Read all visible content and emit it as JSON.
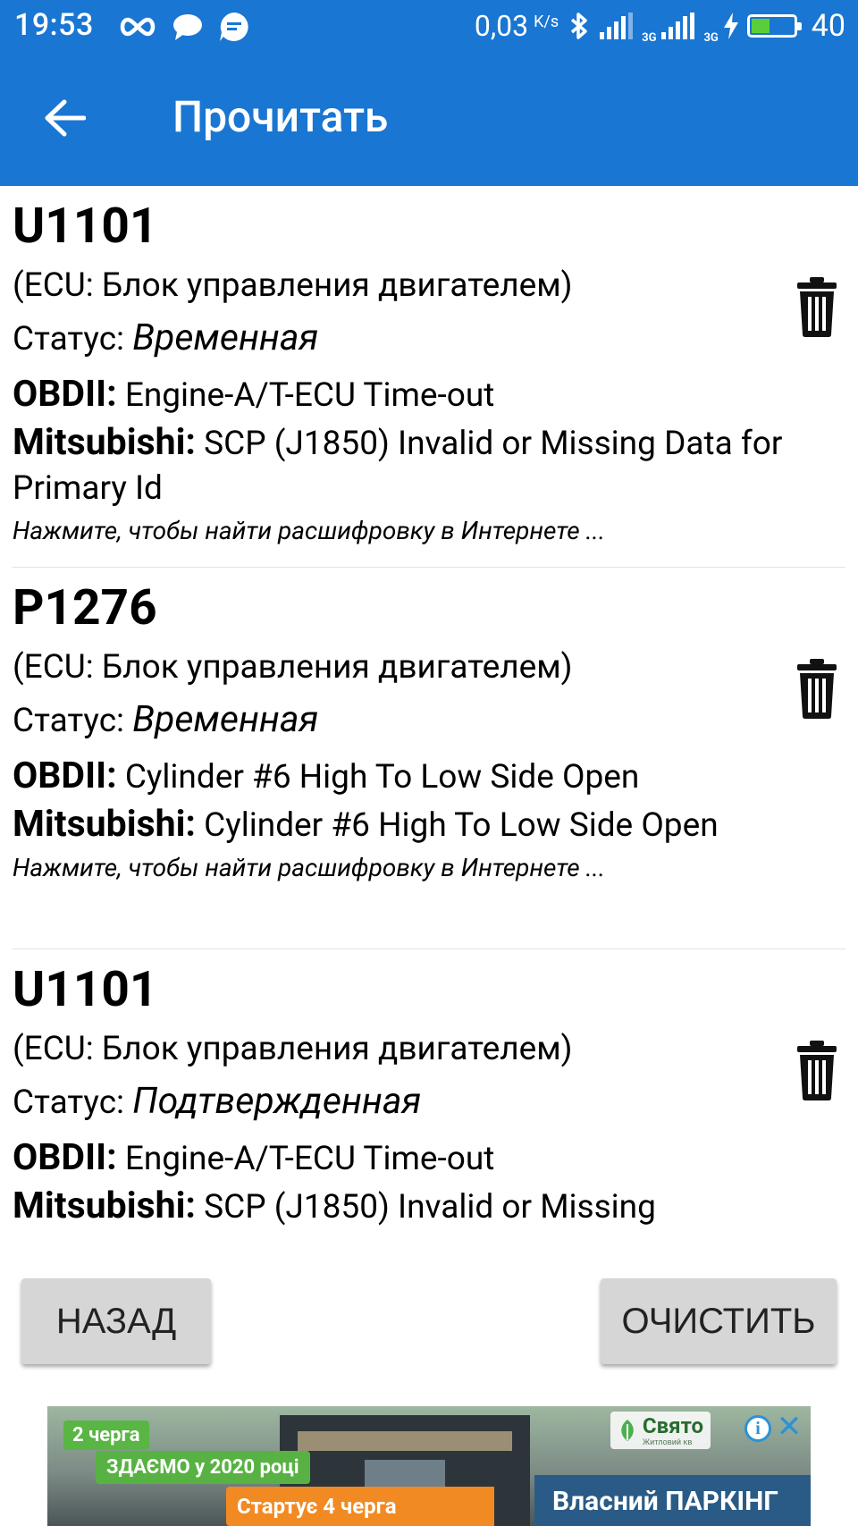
{
  "status_bar": {
    "time": "19:53",
    "net_speed": "0,03",
    "net_speed_unit": "K/s",
    "net_type_1": "3G",
    "net_type_2": "3G",
    "battery_level": "40"
  },
  "toolbar": {
    "title": "Прочитать"
  },
  "labels": {
    "status": "Статус: ",
    "obdii": "OBDII:",
    "mitsubishi": "Mitsubishi:"
  },
  "codes": [
    {
      "code": "U1101",
      "ecu": "(ECU: Блок управления двигателем)",
      "status": "Временная",
      "obdii": "Engine-A/T-ECU Time-out",
      "mitsubishi": "SCP (J1850) Invalid or Missing Data for Primary Id",
      "hint": "Нажмите, чтобы найти расшифровку в Интернете ..."
    },
    {
      "code": "P1276",
      "ecu": "(ECU: Блок управления двигателем)",
      "status": "Временная",
      "obdii": "Cylinder #6 High To Low Side Open",
      "mitsubishi": "Cylinder #6 High To Low Side Open",
      "hint": "Нажмите, чтобы найти расшифровку в Интернете ..."
    },
    {
      "code": "U1101",
      "ecu": "(ECU: Блок управления двигателем)",
      "status": "Подтвержденная",
      "obdii": "Engine-A/T-ECU Time-out",
      "mitsubishi": "SCP (J1850) Invalid or Missing",
      "hint": ""
    }
  ],
  "buttons": {
    "back": "НАЗАД",
    "clear": "ОЧИСТИТЬ"
  },
  "ad": {
    "tag_1": "2 черга",
    "tag_2": "ЗДАЄМО у 2020 році",
    "tag_3": "Стартує 4 черга",
    "brand": "Свято",
    "brand_sub": "Житловий кв",
    "headline": "Власний ПАРКІНГ"
  },
  "colors": {
    "primary": "#1976d2",
    "button_bg": "#d6d6d6",
    "battery_fill": "#5ccd3a"
  }
}
